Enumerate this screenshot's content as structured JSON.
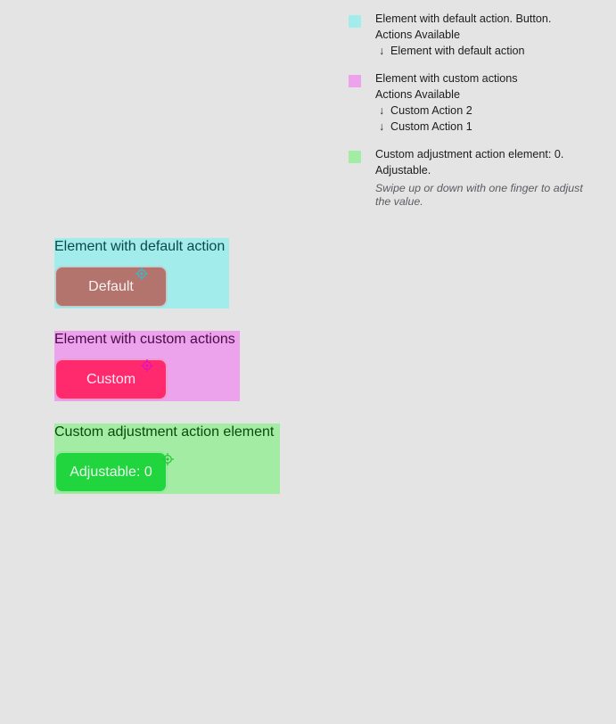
{
  "colors": {
    "background": "#e5e4e5",
    "default_swatch": "#a3ecec",
    "custom_swatch": "#eca3ec",
    "adjustable_swatch": "#a3eca3",
    "default_group_bg": "#a3ecec",
    "custom_group_bg": "#eca3ec",
    "adjustable_group_bg": "#a3eca3",
    "default_title": "#084a4a",
    "custom_title": "#4a0a4a",
    "adjustable_title": "#0b4a0b",
    "default_button": "#b3746d",
    "custom_button": "#ff2a6d",
    "adjustable_button": "#21d53f",
    "default_target": "#3ab9c8",
    "custom_target": "#e011c2",
    "adjustable_target": "#22cc35"
  },
  "legend": {
    "default": {
      "title": "Element with default action. Button.",
      "actions_header": "Actions Available",
      "actions": [
        "Element with default action"
      ]
    },
    "custom": {
      "title": "Element with custom actions",
      "actions_header": "Actions Available",
      "actions": [
        "Custom Action 2",
        "Custom Action 1"
      ]
    },
    "adjustable": {
      "title": "Custom adjustment action element: 0. Adjustable.",
      "hint": "Swipe up or down with one finger to adjust the value."
    },
    "arrow_glyph": "↓"
  },
  "groups": {
    "default": {
      "title": "Element with default action",
      "button_label": "Default",
      "target_icon": "crosshair-icon"
    },
    "custom": {
      "title": "Element with custom actions",
      "button_label": "Custom",
      "target_icon": "crosshair-icon"
    },
    "adjustable": {
      "title": "Custom adjustment action element",
      "button_label": "Adjustable: 0",
      "target_icon": "crosshair-icon"
    }
  }
}
